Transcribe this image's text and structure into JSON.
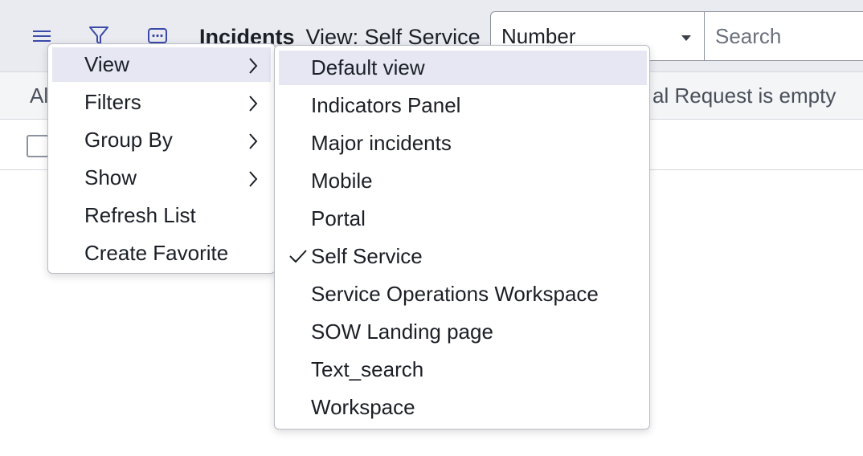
{
  "header": {
    "title": "Incidents",
    "view_label": "View: Self Service",
    "search_field_selected": "Number",
    "search_placeholder": "Search"
  },
  "condition_bar": {
    "start_text": "Al",
    "end_text": "al Request is empty"
  },
  "menu": {
    "items": [
      {
        "label": "View",
        "has_submenu": true
      },
      {
        "label": "Filters",
        "has_submenu": true
      },
      {
        "label": "Group By",
        "has_submenu": true
      },
      {
        "label": "Show",
        "has_submenu": true
      },
      {
        "label": "Refresh List",
        "has_submenu": false
      },
      {
        "label": "Create Favorite",
        "has_submenu": false
      }
    ]
  },
  "submenu": {
    "items": [
      {
        "label": "Default view"
      },
      {
        "label": "Indicators Panel"
      },
      {
        "label": "Major incidents"
      },
      {
        "label": "Mobile"
      },
      {
        "label": "Portal"
      },
      {
        "label": "Self Service",
        "checked": true
      },
      {
        "label": "Service Operations Workspace"
      },
      {
        "label": "SOW Landing page"
      },
      {
        "label": "Text_search"
      },
      {
        "label": "Workspace"
      }
    ]
  },
  "colors": {
    "accent": "#3b49a8",
    "header_bg": "#e9ebf0",
    "hover_bg": "#e6e7f3"
  },
  "icons": [
    "hamburger-menu-icon",
    "filter-icon",
    "more-options-icon",
    "chevron-right-icon",
    "checkmark-icon",
    "dropdown-caret-icon"
  ]
}
